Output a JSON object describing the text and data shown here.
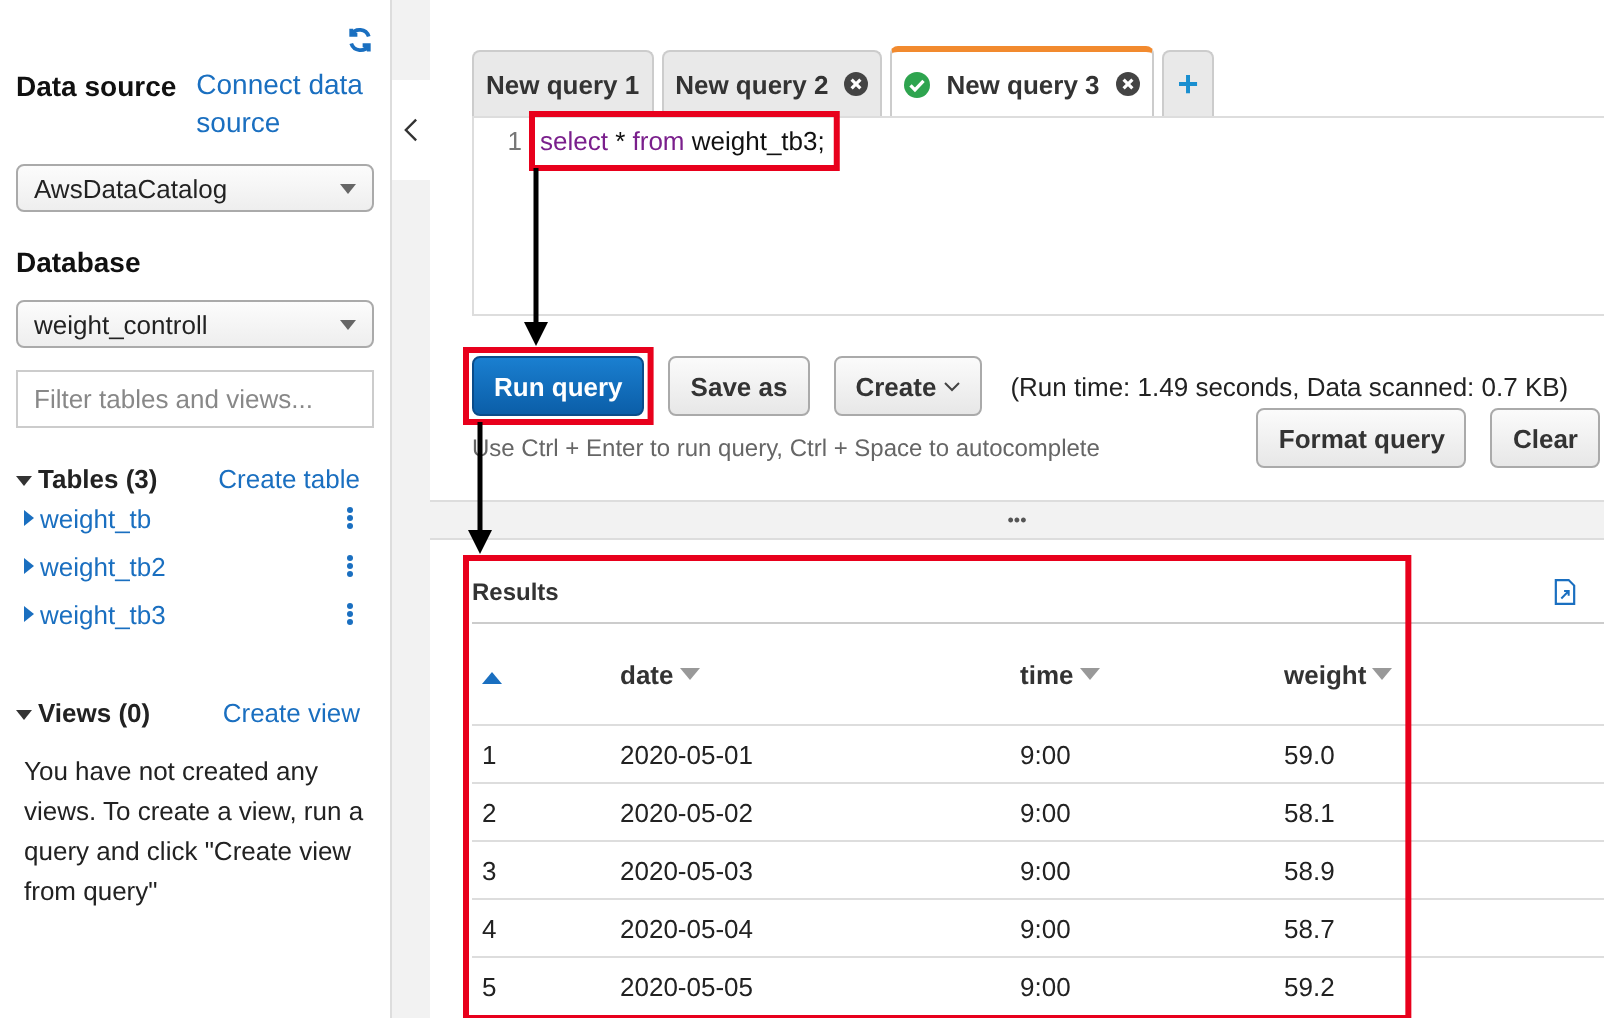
{
  "sidebar": {
    "data_source": {
      "label": "Data source",
      "link": "Connect data source",
      "value": "AwsDataCatalog"
    },
    "database": {
      "label": "Database",
      "value": "weight_controll"
    },
    "filter": {
      "placeholder": "Filter tables and views..."
    },
    "tables": {
      "title": "Tables (3)",
      "expanded": true,
      "action": "Create table",
      "items": [
        {
          "name": "weight_tb",
          "expanded": false
        },
        {
          "name": "weight_tb2",
          "expanded": false
        },
        {
          "name": "weight_tb3",
          "expanded": false
        }
      ]
    },
    "views": {
      "title": "Views (0)",
      "expanded": true,
      "action": "Create view",
      "empty_text": "You have not created any views. To create a view, run a query and click \"Create view from query\""
    }
  },
  "tabs": [
    {
      "label": "New query 1",
      "selected": false,
      "closable": false,
      "succeeded": false
    },
    {
      "label": "New query 2",
      "selected": false,
      "closable": true,
      "succeeded": false
    },
    {
      "label": "New query 3",
      "selected": true,
      "closable": true,
      "succeeded": true
    },
    {
      "label": "+",
      "kind": "add"
    }
  ],
  "editor": {
    "highlighted": true,
    "lines": [
      {
        "number": "1",
        "tokens": [
          {
            "text": "select",
            "kind": "keyword"
          },
          {
            "text": " * ",
            "kind": "plain"
          },
          {
            "text": "from",
            "kind": "keyword"
          },
          {
            "text": " weight_tb3;",
            "kind": "plain"
          }
        ]
      }
    ]
  },
  "toolbar": {
    "run": {
      "label": "Run query",
      "highlighted": true
    },
    "save": {
      "label": "Save as"
    },
    "create": {
      "label": "Create"
    },
    "run_info": "(Run time: 1.49 seconds, Data scanned: 0.7 KB)",
    "hint": "Use Ctrl + Enter to run query, Ctrl + Space to autocomplete",
    "format": {
      "label": "Format query"
    },
    "clear": {
      "label": "Clear"
    }
  },
  "splitter": "•••",
  "results": {
    "title": "Results",
    "highlighted": true,
    "columns": [
      "",
      "date",
      "time",
      "weight"
    ],
    "rows": [
      [
        "1",
        "2020-05-01",
        "9:00",
        "59.0"
      ],
      [
        "2",
        "2020-05-02",
        "9:00",
        "58.1"
      ],
      [
        "3",
        "2020-05-03",
        "9:00",
        "58.9"
      ],
      [
        "4",
        "2020-05-04",
        "9:00",
        "58.7"
      ],
      [
        "5",
        "2020-05-05",
        "9:00",
        "59.2"
      ]
    ]
  }
}
